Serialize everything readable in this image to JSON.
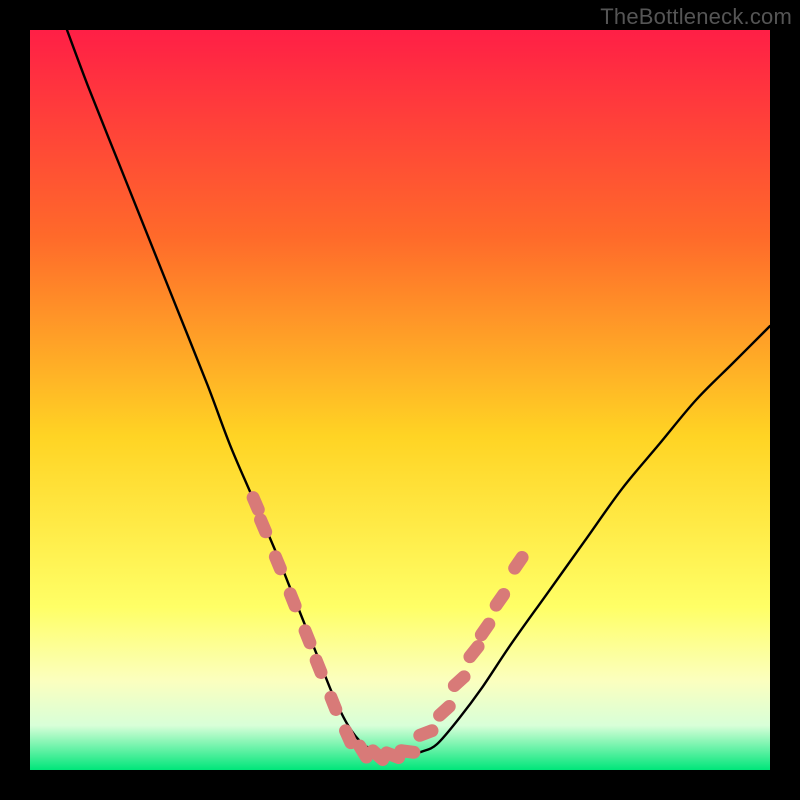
{
  "watermark": "TheBottleneck.com",
  "colors": {
    "frame": "#000000",
    "gradient_top": "#ff1f46",
    "gradient_mid1": "#ff6a2a",
    "gradient_mid2": "#ffd424",
    "gradient_mid3": "#ffff66",
    "gradient_mid4": "#fbffbf",
    "gradient_bottom1": "#d8ffd8",
    "gradient_bottom2": "#00e67a",
    "curve": "#000000",
    "marker_fill": "#d87a78",
    "marker_stroke": "#d87a78"
  },
  "chart_data": {
    "type": "line",
    "title": "",
    "xlabel": "",
    "ylabel": "",
    "xlim": [
      0,
      100
    ],
    "ylim": [
      0,
      100
    ],
    "notes": "Background is a vertical color gradient (red→orange→yellow→pale→green). A single black curve descends steeply from top-left, reaches a flat minimum near y≈2 around x≈42–50, then rises toward the right edge reaching y≈60 at x=100. Salmon capsule-shaped markers sit on the curve near the trough and lower flanks.",
    "series": [
      {
        "name": "curve",
        "x": [
          5,
          8,
          12,
          16,
          20,
          24,
          27,
          30,
          33,
          35,
          37,
          39,
          41,
          43,
          45,
          47,
          49,
          51,
          53,
          55,
          58,
          61,
          65,
          70,
          75,
          80,
          85,
          90,
          95,
          100
        ],
        "y": [
          100,
          92,
          82,
          72,
          62,
          52,
          44,
          37,
          30,
          25,
          20,
          15,
          10,
          6,
          3.5,
          2.5,
          2,
          2,
          2.5,
          3.5,
          7,
          11,
          17,
          24,
          31,
          38,
          44,
          50,
          55,
          60
        ]
      }
    ],
    "markers": {
      "name": "capsule-markers",
      "points": [
        {
          "x": 30.5,
          "y": 36
        },
        {
          "x": 31.5,
          "y": 33
        },
        {
          "x": 33.5,
          "y": 28
        },
        {
          "x": 35.5,
          "y": 23
        },
        {
          "x": 37.5,
          "y": 18
        },
        {
          "x": 39.0,
          "y": 14
        },
        {
          "x": 41.0,
          "y": 9
        },
        {
          "x": 43.0,
          "y": 4.5
        },
        {
          "x": 45.0,
          "y": 2.5
        },
        {
          "x": 47.0,
          "y": 2
        },
        {
          "x": 49.0,
          "y": 2
        },
        {
          "x": 51.0,
          "y": 2.5
        },
        {
          "x": 53.5,
          "y": 5
        },
        {
          "x": 56.0,
          "y": 8
        },
        {
          "x": 58.0,
          "y": 12
        },
        {
          "x": 60.0,
          "y": 16
        },
        {
          "x": 61.5,
          "y": 19
        },
        {
          "x": 63.5,
          "y": 23
        },
        {
          "x": 66.0,
          "y": 28
        }
      ]
    }
  }
}
